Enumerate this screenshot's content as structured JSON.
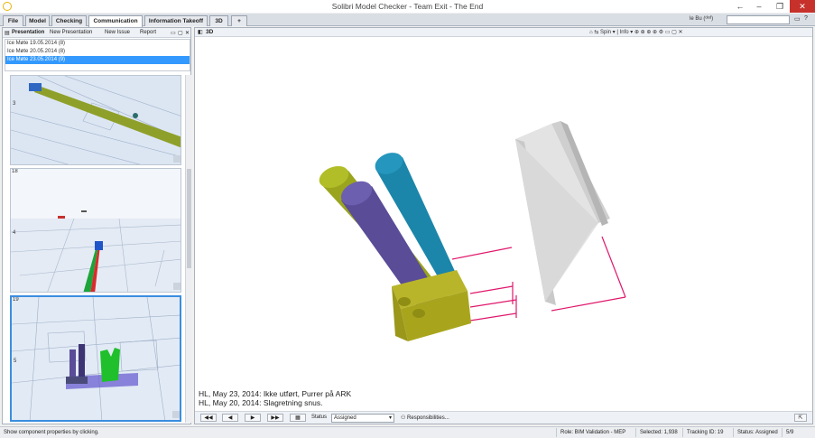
{
  "window": {
    "title": "Solibri Model Checker - Team Exit - The End",
    "minimize": "–",
    "maximize": "❐",
    "close": "✕"
  },
  "tabs": [
    {
      "label": "File"
    },
    {
      "label": "Model"
    },
    {
      "label": "Checking"
    },
    {
      "label": "Communication",
      "active": true
    },
    {
      "label": "Information Takeoff"
    },
    {
      "label": "3D"
    },
    {
      "label": "+"
    }
  ],
  "topbar": {
    "user": "le Bu (ᵈᵉᵈ)",
    "search_placeholder": ""
  },
  "left_panel": {
    "title": "Presentation",
    "actions": [
      "New Presentation",
      "New Issue",
      "Report"
    ],
    "presentations": [
      {
        "label": "Ice Møte 19.05.2014 (8)"
      },
      {
        "label": "Ice Møte 20.05.2014 (8)"
      },
      {
        "label": "Ice Møte 23.05.2014 (9)",
        "selected": true
      }
    ],
    "thumbnails": [
      {
        "num": "",
        "side": "3"
      },
      {
        "num": "18",
        "side": "4"
      },
      {
        "num": "19",
        "side": "5",
        "selected": true
      }
    ]
  },
  "view": {
    "title": "3D",
    "toolbar": "Spin ▾ | Info ▾",
    "comments": [
      "HL, May 23, 2014: Ikke utført, Purrer på ARK",
      "HL, May 20, 2014: Slagretning snus."
    ],
    "nav": [
      "◀◀",
      "◀",
      "▶",
      "▶▶",
      "▦"
    ],
    "status_label": "Status",
    "status_value": "Assigned",
    "responsibilities": "Responsibilities..."
  },
  "statusbar": {
    "hint": "Show component properties by clicking.",
    "role": "Role: BIM Validation - MEP",
    "selected": "Selected: 1,938",
    "tracking": "Tracking ID: 19",
    "status": "Status: Assigned",
    "page": "5/9"
  },
  "colors": {
    "pipe_olive": "#9aa51d",
    "pipe_purple": "#5a4c97",
    "pipe_teal": "#1b86aa",
    "block": "#a8a51d",
    "door": "#d7d7d7",
    "dimension": "#e0186c"
  }
}
